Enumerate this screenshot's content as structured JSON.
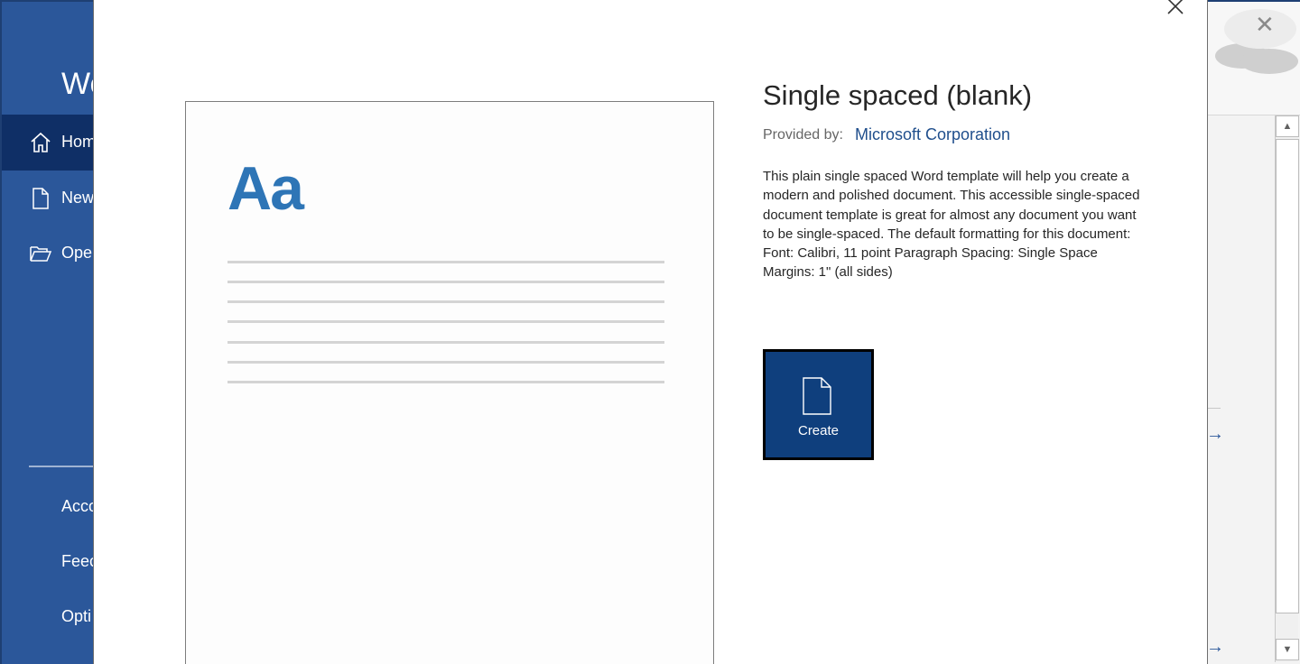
{
  "sidebar": {
    "app_title": "We",
    "items": [
      {
        "label": "Hom",
        "icon": "home-icon",
        "active": true
      },
      {
        "label": "New",
        "icon": "new-document-icon",
        "active": false
      },
      {
        "label": "Ope",
        "icon": "open-folder-icon",
        "active": false
      }
    ],
    "bottom_items": [
      {
        "label": "Acco"
      },
      {
        "label": "Feec"
      },
      {
        "label": "Opti"
      }
    ]
  },
  "dialog": {
    "title": "Single spaced (blank)",
    "provided_by_label": "Provided by:",
    "provider": "Microsoft Corporation",
    "description": "This plain single spaced Word template will help you create a modern and polished document. This accessible single-spaced document template is great for almost any document you want to be single-spaced. The default formatting for this document: Font: Calibri, 11 point Paragraph Spacing: Single Space Margins: 1\" (all sides)",
    "preview_text": "Aa",
    "create_label": "Create",
    "close_icon": "close-icon"
  },
  "background_window": {
    "close_glyph": "✕",
    "arrow_glyph": "→",
    "scroll_up_glyph": "▲",
    "scroll_down_glyph": "▼"
  },
  "colors": {
    "sidebar": "#2b579a",
    "sidebar_active": "#0f2f66",
    "create_button": "#0f3f7d",
    "preview_accent": "#2e75b6",
    "provider_link": "#1f4e8c"
  }
}
